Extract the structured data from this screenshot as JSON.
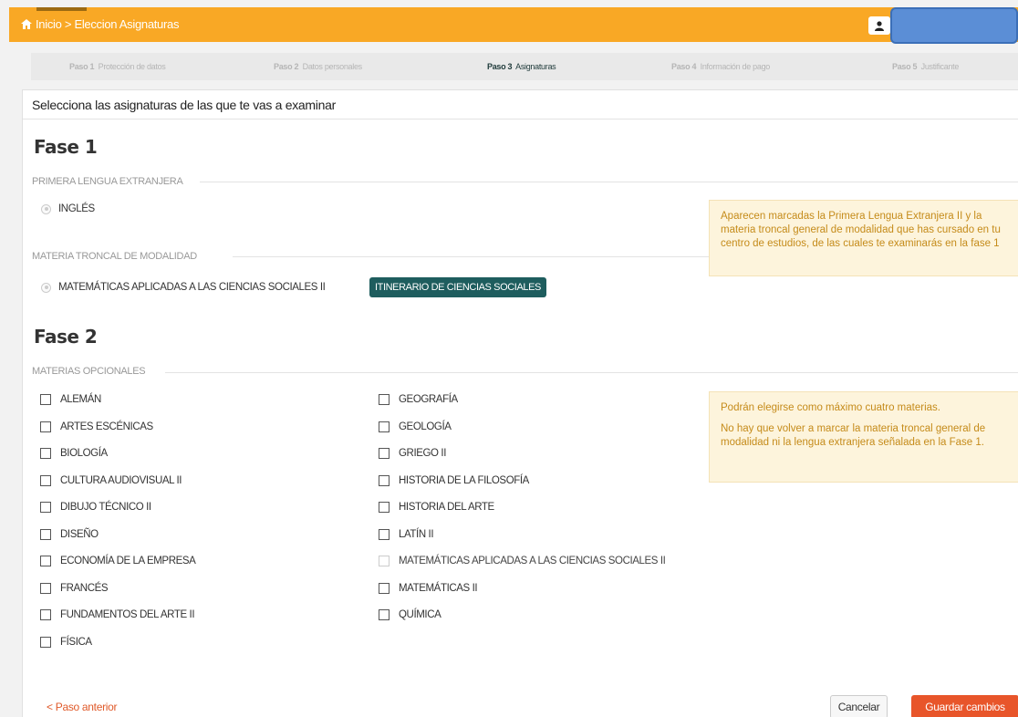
{
  "header": {
    "breadcrumb": "Inicio > Eleccion Asignaturas"
  },
  "steps": [
    {
      "num": "Paso 1",
      "label": "Protección de datos"
    },
    {
      "num": "Paso 2",
      "label": "Datos personales"
    },
    {
      "num": "Paso 3",
      "label": "Asignaturas"
    },
    {
      "num": "Paso 4",
      "label": "Información de pago"
    },
    {
      "num": "Paso 5",
      "label": "Justificante"
    }
  ],
  "panel": {
    "title": "Selecciona las asignaturas de las que te vas a examinar"
  },
  "fase1": {
    "title": "Fase 1",
    "lengua_label": "PRIMERA LENGUA EXTRANJERA",
    "lengua_option": "INGLÉS",
    "troncal_label": "MATERIA TRONCAL DE MODALIDAD",
    "troncal_option": "MATEMÁTICAS APLICADAS A LAS CIENCIAS SOCIALES II",
    "itinerario_badge": "ITINERARIO DE CIENCIAS SOCIALES",
    "note": "Aparecen marcadas la Primera Lengua Extranjera II y la materia troncal general de modalidad que has cursado en tu centro de estudios, de las cuales te examinarás en la fase 1"
  },
  "fase2": {
    "title": "Fase 2",
    "opcionales_label": "MATERIAS OPCIONALES",
    "col1": [
      "ALEMÁN",
      "ARTES ESCÉNICAS",
      "BIOLOGÍA",
      "CULTURA AUDIOVISUAL II",
      "DIBUJO TÉCNICO II",
      "DISEÑO",
      "ECONOMÍA DE LA EMPRESA",
      "FRANCÉS",
      "FUNDAMENTOS DEL ARTE II",
      "FÍSICA"
    ],
    "col2": [
      "GEOGRAFÍA",
      "GEOLOGÍA",
      "GRIEGO II",
      "HISTORIA DE LA FILOSOFÍA",
      "HISTORIA DEL ARTE",
      "LATÍN II",
      "MATEMÁTICAS APLICADAS A LAS CIENCIAS SOCIALES II",
      "MATEMÁTICAS II",
      "QUÍMICA"
    ],
    "note1": "Podrán elegirse como máximo cuatro materias.",
    "note2": "No hay que volver a marcar la materia troncal general de modalidad ni la lengua extranjera señalada en la Fase 1."
  },
  "footer": {
    "prev_label": "< Paso anterior",
    "cancel_label": "Cancelar",
    "save_label": "Guardar cambios"
  }
}
